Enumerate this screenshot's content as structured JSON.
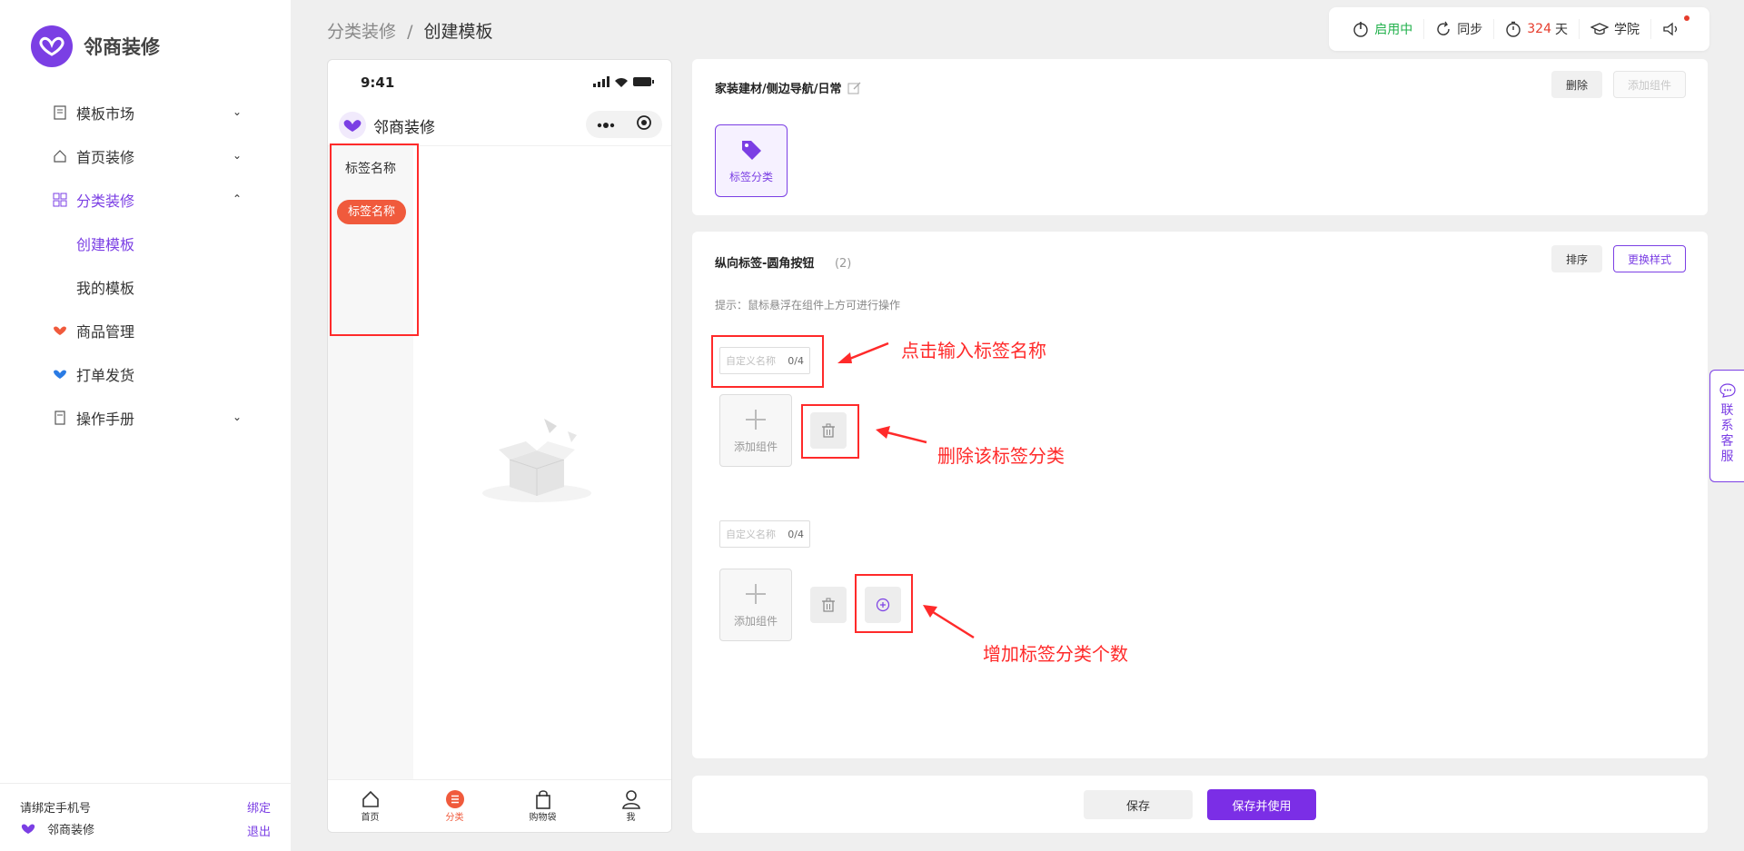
{
  "brand": {
    "name": "邻商装修",
    "color": "#7b3fe4"
  },
  "sidebar": {
    "items": [
      {
        "label": "模板市场",
        "icon": "template-icon",
        "chevron": "⌄"
      },
      {
        "label": "首页装修",
        "icon": "home-icon",
        "chevron": "⌄"
      },
      {
        "label": "分类装修",
        "icon": "category-icon",
        "chevron": "⌃",
        "active": true
      },
      {
        "label": "创建模板",
        "sub": true,
        "active": true
      },
      {
        "label": "我的模板",
        "sub": true
      },
      {
        "label": "商品管理",
        "icon": "goods-icon"
      },
      {
        "label": "打单发货",
        "icon": "shipping-icon"
      },
      {
        "label": "操作手册",
        "icon": "manual-icon",
        "chevron": "⌄"
      }
    ],
    "footer": {
      "phone_prompt": "请绑定手机号",
      "bind": "绑定",
      "shop_name": "邻商装修",
      "logout": "退出"
    }
  },
  "breadcrumb": {
    "parent": "分类装修",
    "separator": "/",
    "current": "创建模板"
  },
  "topbar": {
    "status": "启用中",
    "sync": "同步",
    "days_value": "324",
    "days_unit": "天",
    "academy": "学院"
  },
  "phone": {
    "time": "9:41",
    "title": "邻商装修",
    "tag_plain": "标签名称",
    "tag_active": "标签名称",
    "tabs": [
      {
        "label": "首页",
        "icon": "home-icon"
      },
      {
        "label": "分类",
        "icon": "list-icon",
        "active": true
      },
      {
        "label": "购物袋",
        "icon": "bag-icon"
      },
      {
        "label": "我",
        "icon": "user-icon"
      }
    ]
  },
  "panel1": {
    "path": "家装建材/侧边导航/日常",
    "delete": "删除",
    "add_component": "添加组件",
    "card_label": "标签分类"
  },
  "panel2": {
    "title": "纵向标签-圆角按钮",
    "count": "(2)",
    "sort": "排序",
    "change_style": "更换样式",
    "hint": "提示：鼠标悬浮在组件上方可进行操作",
    "groups": [
      {
        "placeholder": "自定义名称",
        "counter": "0/4",
        "add": "添加组件"
      },
      {
        "placeholder": "自定义名称",
        "counter": "0/4",
        "add": "添加组件"
      }
    ]
  },
  "annotations": {
    "input_name": "点击输入标签名称",
    "delete_tag": "删除该标签分类",
    "add_tag": "增加标签分类个数"
  },
  "footer_actions": {
    "save": "保存",
    "save_use": "保存并使用"
  },
  "service": {
    "label": "联系客服",
    "chars": [
      "联",
      "系",
      "客",
      "服"
    ]
  }
}
